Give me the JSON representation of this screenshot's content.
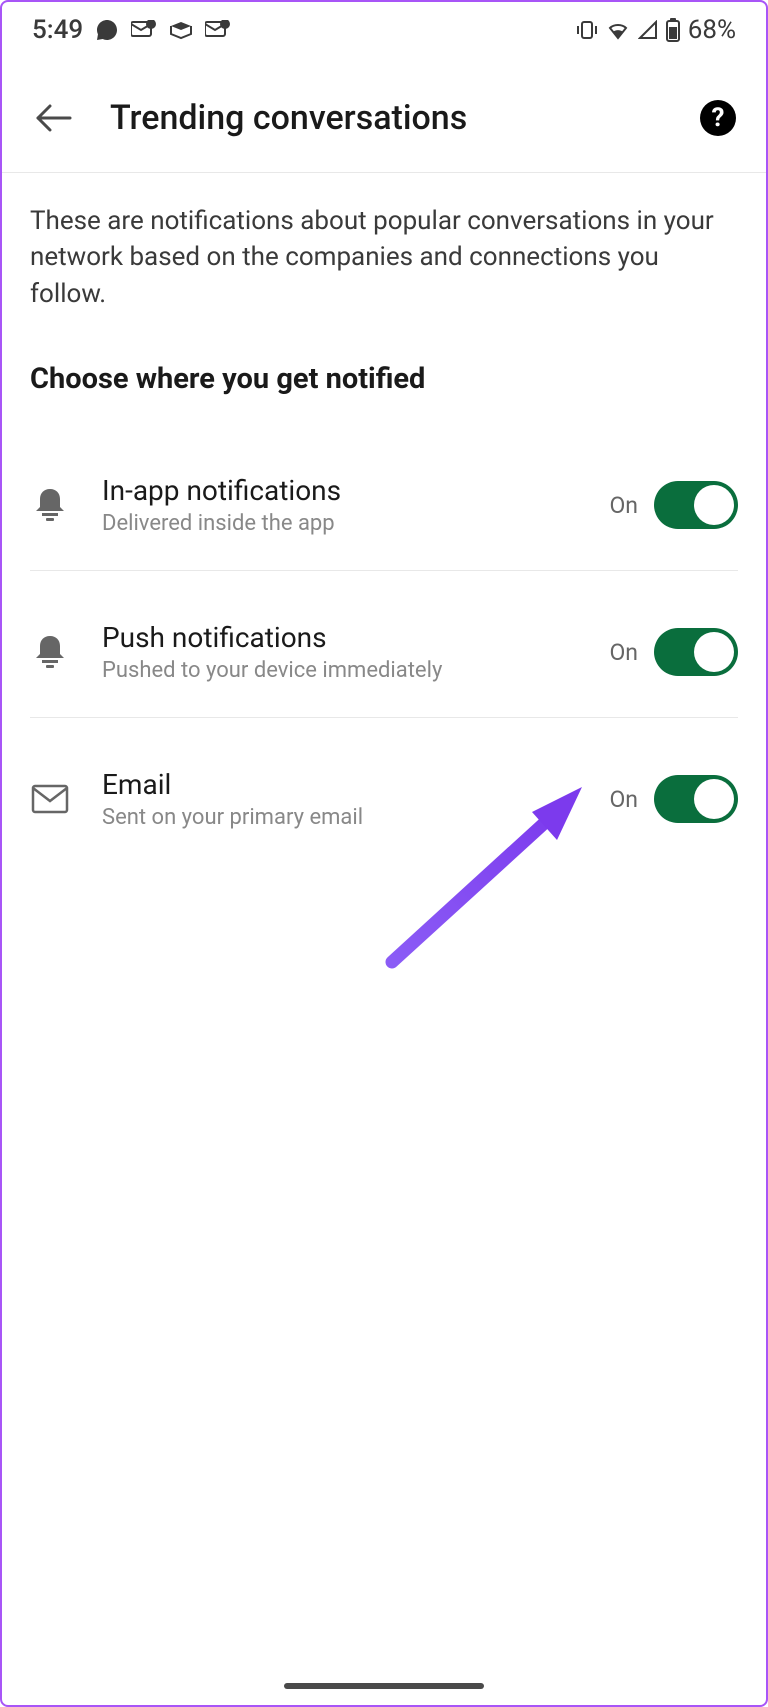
{
  "statusBar": {
    "time": "5:49",
    "batteryPercent": "68%"
  },
  "header": {
    "title": "Trending conversations"
  },
  "content": {
    "description": "These are notifications about popular conversations in your network based on the companies and connections you follow.",
    "sectionHeading": "Choose where you get notified"
  },
  "settings": [
    {
      "title": "In-app notifications",
      "subtitle": "Delivered inside the app",
      "state": "On"
    },
    {
      "title": "Push notifications",
      "subtitle": "Pushed to your device immediately",
      "state": "On"
    },
    {
      "title": "Email",
      "subtitle": "Sent on your primary email",
      "state": "On"
    }
  ]
}
